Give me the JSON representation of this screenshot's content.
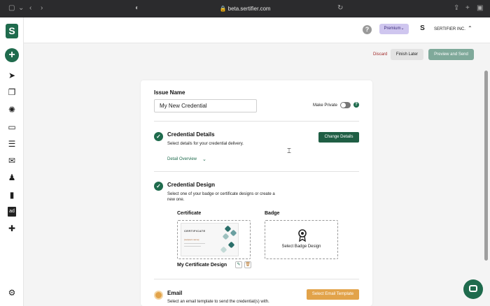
{
  "browser": {
    "url": "beta.sertifier.com",
    "back_glyph": "‹",
    "forward_glyph": "›",
    "reload_glyph": "↻",
    "share_glyph": "⇪",
    "newtab_glyph": "+",
    "tabs_glyph": "▣"
  },
  "sidebar": {
    "logo_text": "S",
    "plus_glyph": "+",
    "items": [
      {
        "icon": "send-icon",
        "glyph": "➤"
      },
      {
        "icon": "documents-icon",
        "glyph": "❐"
      },
      {
        "icon": "gear-cog-icon",
        "glyph": "✺"
      },
      {
        "icon": "monitor-icon",
        "glyph": "▭"
      },
      {
        "icon": "list-icon",
        "glyph": "☰"
      },
      {
        "icon": "mail-icon",
        "glyph": "✉"
      },
      {
        "icon": "users-icon",
        "glyph": "♟"
      },
      {
        "icon": "analytics-icon",
        "glyph": "▮"
      },
      {
        "icon": "ad-icon",
        "glyph": "ad"
      },
      {
        "icon": "gift-icon",
        "glyph": "✚"
      }
    ],
    "settings_glyph": "⚙"
  },
  "topbar": {
    "help": "?",
    "premium": "Premium",
    "avatar": "S",
    "company": "SERTIFIER INC.",
    "caret": "⌃"
  },
  "actions": {
    "discard": "Discard",
    "finish_later": "Finish Later",
    "preview_send": "Preview and Send"
  },
  "form": {
    "issue_name_label": "Issue Name",
    "issue_name_value": "My New Credential",
    "make_private_label": "Make Private",
    "make_private_on": false,
    "info": "?",
    "check": "✓",
    "credential_details": {
      "title": "Credential Details",
      "description": "Select details for your credential delivery.",
      "button": "Change Details",
      "overview": "Detail Overview",
      "caret": "⌄"
    },
    "credential_design": {
      "title": "Credential Design",
      "description_line1": "Select one of your badge or certificate designs or create a",
      "description_line2": "new one.",
      "certificate_label": "Certificate",
      "badge_label": "Badge",
      "certificate_caption": "My Certificate Design",
      "select_badge": "Select Badge Design",
      "thumb_title": "CERTIFICATE",
      "thumb_name": "[recipient.name]",
      "edit_glyph": "✎",
      "delete_glyph": "🗑"
    },
    "email": {
      "title": "Email",
      "description": "Select an email template to send the credential(s) with.",
      "button": "Select Email Template"
    }
  },
  "colors": {
    "brand_green": "#1f6b4d",
    "accent_orange": "#e2a34a",
    "premium": "#cfc6ef",
    "discard_red": "#a12a2a"
  }
}
